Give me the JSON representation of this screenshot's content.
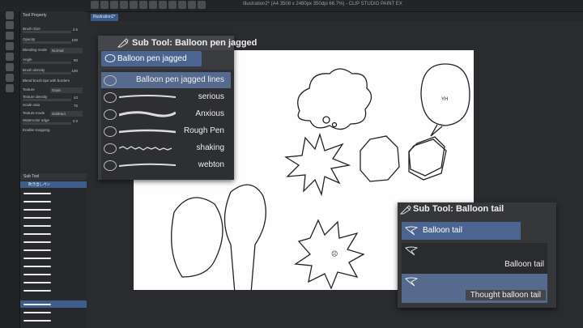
{
  "window": {
    "title": "Illustration2* (A4 3508 x 2480px 350dpi 66.7%) - CLIP STUDIO PAINT EX",
    "doc_tab": "Illustration2*"
  },
  "tool_property": {
    "title": "Tool Property",
    "rows": [
      {
        "label": "Brush Size",
        "value": "4.5"
      },
      {
        "label": "Opacity",
        "value": "100"
      },
      {
        "label": "Blending mode",
        "value": "Normal"
      },
      {
        "label": "Angle",
        "value": "90"
      },
      {
        "label": "Brush density",
        "value": "100"
      },
      {
        "label": "Blend brush tips with borders",
        "value": ""
      },
      {
        "label": "Texture",
        "value": "Grain"
      },
      {
        "label": "Texture density",
        "value": "43"
      },
      {
        "label": "Scale ratio",
        "value": "76"
      },
      {
        "label": "Texture mode",
        "value": "Subtract"
      },
      {
        "label": "Watercolor edge",
        "value": "2.0"
      },
      {
        "label": "Enable snapping",
        "value": ""
      }
    ]
  },
  "subtool_left": {
    "header": "Sub Tool",
    "selected_top": "吹き出しペン"
  },
  "pen_panel": {
    "title": "Sub Tool: Balloon pen jagged",
    "selected": "Balloon pen jagged lines",
    "items": [
      {
        "label": "Balloon pen jagged lines",
        "selected": true
      },
      {
        "label": "serious",
        "selected": false
      },
      {
        "label": "Anxious",
        "selected": false
      },
      {
        "label": "Rough Pen",
        "selected": false
      },
      {
        "label": "shaking",
        "selected": false
      },
      {
        "label": "webton",
        "selected": false
      }
    ]
  },
  "tail_panel": {
    "title": "Sub Tool: Balloon tail",
    "selected": "Balloon tail",
    "items": [
      {
        "label": "Balloon tail",
        "selected": false
      },
      {
        "label": "Thought balloon tail",
        "selected": true
      }
    ]
  },
  "canvas": {
    "balloon_text": "YH"
  },
  "colors": {
    "accent": "#4c6590",
    "panel": "#3a3b3f",
    "background": "#2a2b2e"
  }
}
